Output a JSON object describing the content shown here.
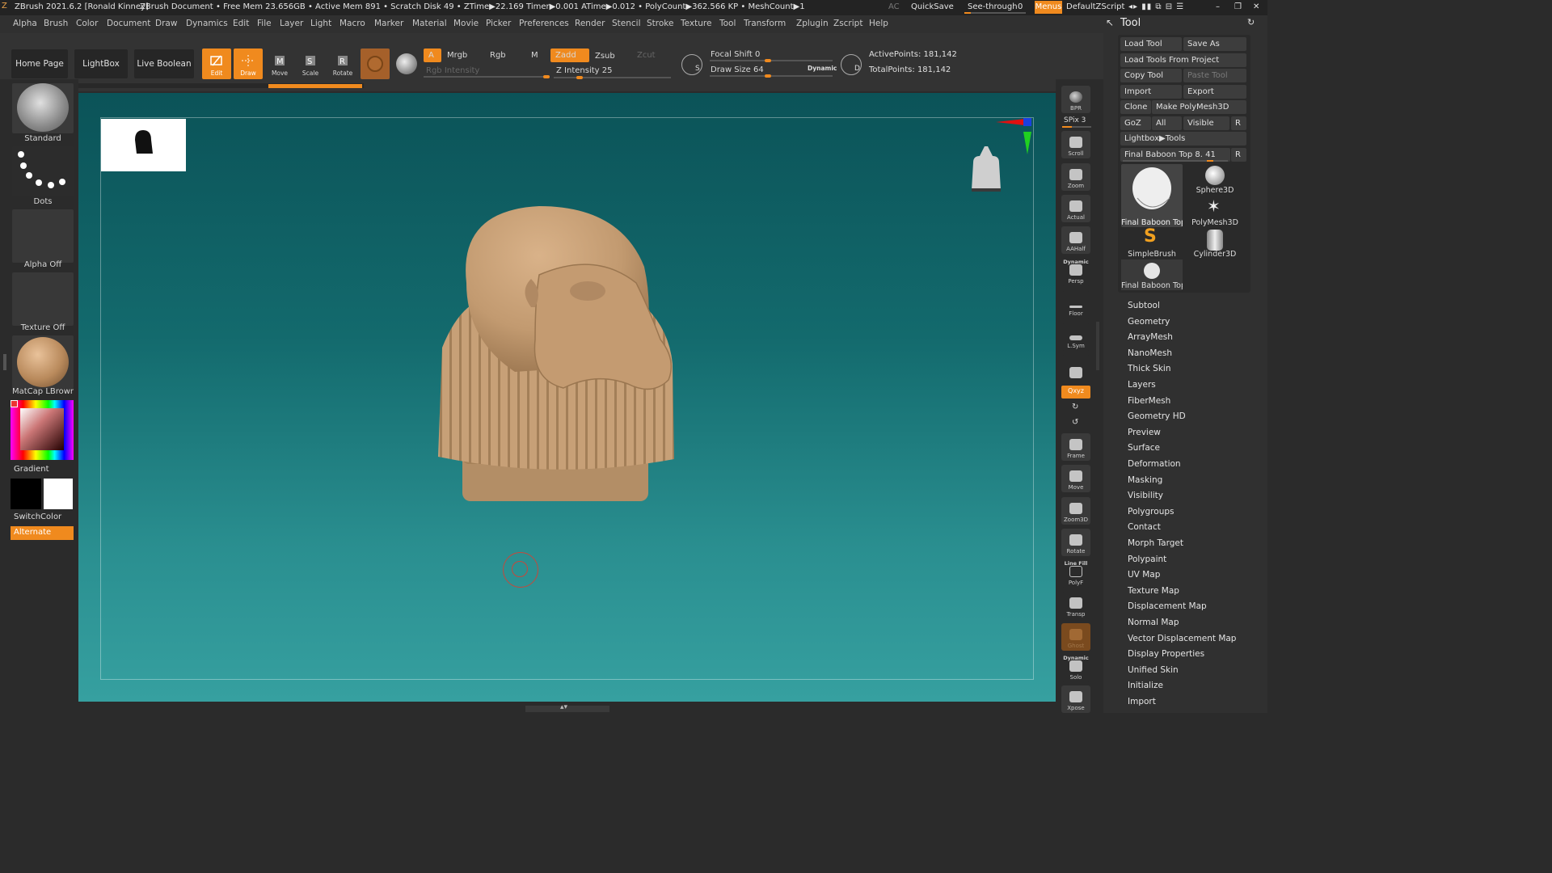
{
  "titlebar": {
    "app": "ZBrush 2021.6.2 [Ronald Kinney]",
    "doc": "ZBrush Document",
    "stats": "• Free Mem 23.656GB • Active Mem 891 • Scratch Disk 49 • ZTime▶22.169 Timer▶0.001 ATime▶0.012 • PolyCount▶362.566 KP • MeshCount▶1",
    "ac": "AC",
    "quicksave": "QuickSave",
    "seethrough": "See-through",
    "seethrough_value": "0",
    "menus": "Menus",
    "script": "DefaultZScript"
  },
  "menubar": [
    "Alpha",
    "Brush",
    "Color",
    "Document",
    "Draw",
    "Dynamics",
    "Edit",
    "File",
    "Layer",
    "Light",
    "Macro",
    "Marker",
    "Material",
    "Movie",
    "Picker",
    "Preferences",
    "Render",
    "Stencil",
    "Stroke",
    "Texture",
    "Tool",
    "Transform",
    "Zplugin",
    "Zscript",
    "Help"
  ],
  "shelf": {
    "home": "Home Page",
    "lightbox": "LightBox",
    "liveboolean": "Live Boolean",
    "edit": "Edit",
    "draw": "Draw",
    "move": "Move",
    "scale": "Scale",
    "rotate": "Rotate",
    "a": "A",
    "mrgb": "Mrgb",
    "rgb": "Rgb",
    "m": "M",
    "rgb_intensity": "Rgb Intensity",
    "zadd": "Zadd",
    "zsub": "Zsub",
    "zcut": "Zcut",
    "z_intensity": "Z Intensity 25",
    "focal_shift": "Focal Shift 0",
    "draw_size": "Draw Size 64",
    "dynamic": "Dynamic",
    "s_label": "S",
    "d_label": "D",
    "active_points": "ActivePoints: 181,142",
    "total_points": "TotalPoints: 181,142"
  },
  "sliders": {
    "rgb_intensity": 1.0,
    "z_intensity": 0.25,
    "focal_shift": 0.5,
    "draw_size": 0.5,
    "spix": 0.4,
    "subtool_slider": 0.8
  },
  "leftpanel": {
    "brush": "Standard",
    "stroke": "Dots",
    "alpha": "Alpha Off",
    "texture": "Texture Off",
    "material": "MatCap LBrown",
    "gradient": "Gradient",
    "switchcolor": "SwitchColor",
    "alternate": "Alternate"
  },
  "rightshelf": {
    "bpr": "BPR",
    "spix": "SPix 3",
    "scroll": "Scroll",
    "zoom": "Zoom",
    "actual": "Actual",
    "aahalf": "AAHalf",
    "dynamic_top": "Dynamic",
    "persp": "Persp",
    "floor": "Floor",
    "lsym": "L.Sym",
    "xyz": "Qxyz",
    "frame": "Frame",
    "move": "Move",
    "zoom3d": "Zoom3D",
    "rotate": "Rotate",
    "linefill": "Line Fill",
    "polyf": "PolyF",
    "transp": "Transp",
    "ghost": "Ghost",
    "dynamic_solo": "Dynamic",
    "solo": "Solo",
    "xpose": "Xpose"
  },
  "toolpanel": {
    "title": "Tool",
    "load_tool": "Load Tool",
    "save_as": "Save As",
    "load_from_project": "Load Tools From Project",
    "copy_tool": "Copy Tool",
    "paste_tool": "Paste Tool",
    "import": "Import",
    "export": "Export",
    "clone": "Clone",
    "make_polymesh": "Make PolyMesh3D",
    "goz": "GoZ",
    "all": "All",
    "visible": "Visible",
    "r": "R",
    "lightbox_tools": "Lightbox▶Tools",
    "current_tool": "Final Baboon Top 8. 41",
    "r2": "R",
    "thumbs": [
      "Final Baboon Top",
      "Sphere3D",
      "Final Baboon Top",
      "PolyMesh3D",
      "SimpleBrush",
      "Cylinder3D",
      "Final Baboon Top"
    ],
    "sections": [
      "Subtool",
      "Geometry",
      "ArrayMesh",
      "NanoMesh",
      "Thick Skin",
      "Layers",
      "FiberMesh",
      "Geometry HD",
      "Preview",
      "Surface",
      "Deformation",
      "Masking",
      "Visibility",
      "Polygroups",
      "Contact",
      "Morph Target",
      "Polypaint",
      "UV Map",
      "Texture Map",
      "Displacement Map",
      "Normal Map",
      "Vector Displacement Map",
      "Display Properties",
      "Unified Skin",
      "Initialize",
      "Import"
    ]
  },
  "colors": {
    "accent": "#f08a1e",
    "canvas_top": "#0b5358",
    "canvas_bottom": "#36a0a0",
    "model": "#c8a079"
  }
}
